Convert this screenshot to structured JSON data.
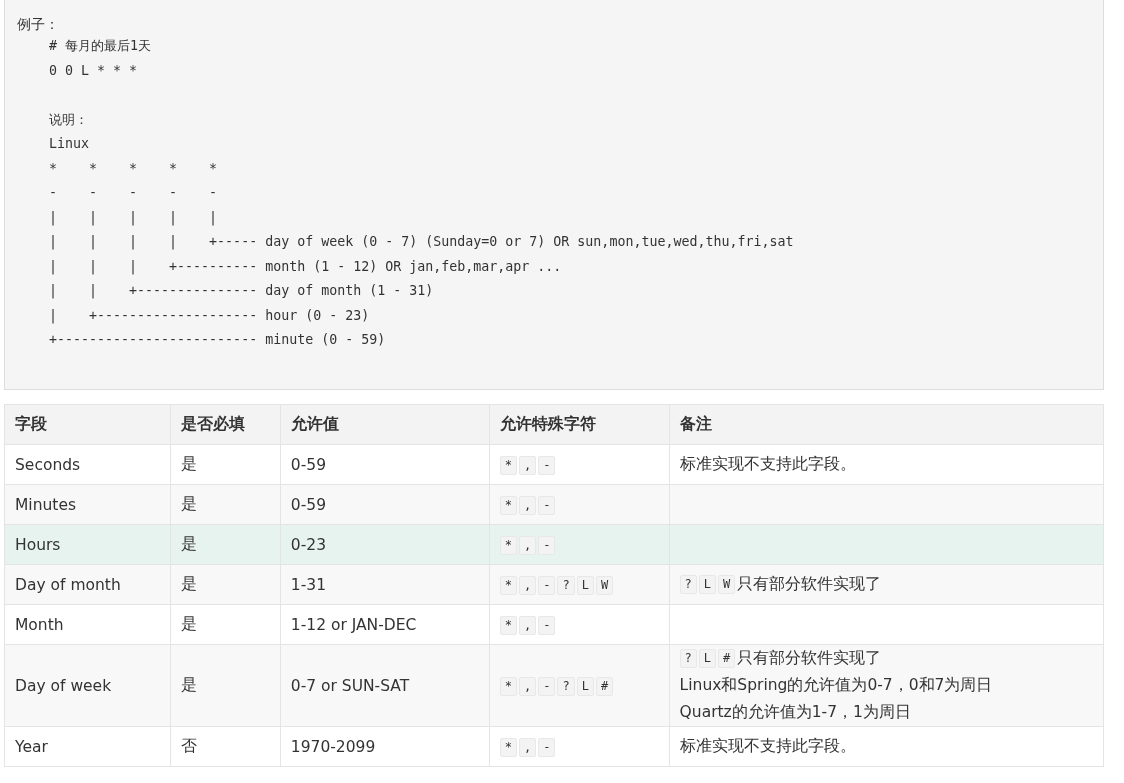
{
  "code_block": {
    "label": "例子：",
    "example_lines": [
      "# 每月的最后1天",
      "0 0 L * * *"
    ],
    "explanation_lines": [
      "说明：",
      "Linux",
      "*    *    *    *    *",
      "-    -    -    -    -",
      "|    |    |    |    |",
      "|    |    |    |    +----- day of week (0 - 7) (Sunday=0 or 7) OR sun,mon,tue,wed,thu,fri,sat",
      "|    |    |    +---------- month (1 - 12) OR jan,feb,mar,apr ...",
      "|    |    +--------------- day of month (1 - 31)",
      "|    +-------------------- hour (0 - 23)",
      "+------------------------- minute (0 - 59)"
    ]
  },
  "table": {
    "columns": [
      "字段",
      "是否必填",
      "允许值",
      "允许特殊字符",
      "备注"
    ],
    "rows": [
      {
        "field": "Seconds",
        "required": "是",
        "allowed": "0-59",
        "special_chars": [
          "*",
          ",",
          "-"
        ],
        "notes": [
          {
            "text": "标准实现不支持此字段。"
          }
        ],
        "highlighted": false
      },
      {
        "field": "Minutes",
        "required": "是",
        "allowed": "0-59",
        "special_chars": [
          "*",
          ",",
          "-"
        ],
        "notes": [],
        "highlighted": false
      },
      {
        "field": "Hours",
        "required": "是",
        "allowed": "0-23",
        "special_chars": [
          "*",
          ",",
          "-"
        ],
        "notes": [],
        "highlighted": true
      },
      {
        "field": "Day of month",
        "required": "是",
        "allowed": "1-31",
        "special_chars": [
          "*",
          ",",
          "-",
          "?",
          "L",
          "W"
        ],
        "notes": [
          {
            "chips": [
              "?",
              "L",
              "W"
            ],
            "text": "只有部分软件实现了"
          }
        ],
        "highlighted": false
      },
      {
        "field": "Month",
        "required": "是",
        "allowed": "1-12 or JAN-DEC",
        "special_chars": [
          "*",
          ",",
          "-"
        ],
        "notes": [],
        "highlighted": false
      },
      {
        "field": "Day of week",
        "required": "是",
        "allowed": "0-7 or SUN-SAT",
        "special_chars": [
          "*",
          ",",
          "-",
          "?",
          "L",
          "#"
        ],
        "notes": [
          {
            "chips": [
              "?",
              "L",
              "#"
            ],
            "text": "只有部分软件实现了"
          },
          {
            "text": "Linux和Spring的允许值为0-7，0和7为周日"
          },
          {
            "text": "Quartz的允许值为1-7，1为周日"
          }
        ],
        "highlighted": false
      },
      {
        "field": "Year",
        "required": "否",
        "allowed": "1970-2099",
        "special_chars": [
          "*",
          ",",
          "-"
        ],
        "notes": [
          {
            "text": "标准实现不支持此字段。"
          }
        ],
        "highlighted": false
      }
    ]
  }
}
